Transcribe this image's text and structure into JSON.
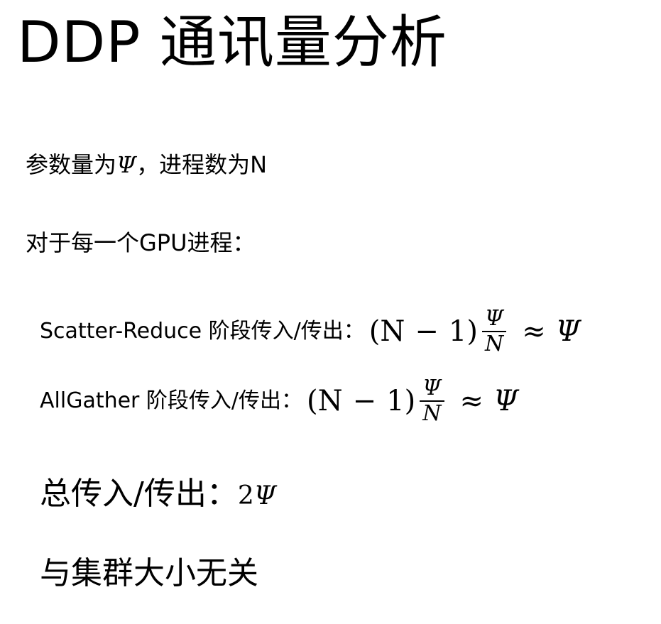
{
  "title": "DDP 通讯量分析",
  "intro": {
    "prefix": "参数量为",
    "var_params": "Ψ",
    "middle": "，进程数为N"
  },
  "per_gpu_label": "对于每一个GPU进程：",
  "scatter_reduce": {
    "label": "Scatter-Reduce 阶段传入/传出：",
    "formula": {
      "lparen": "(N",
      "minus": "−",
      "rparen": "1)",
      "num": "Ψ",
      "den": "N",
      "approx": "≈",
      "result": "Ψ"
    }
  },
  "allgather": {
    "label": "AllGather 阶段传入/传出：",
    "formula": {
      "lparen": "(N",
      "minus": "−",
      "rparen": "1)",
      "num": "Ψ",
      "den": "N",
      "approx": "≈",
      "result": "Ψ"
    }
  },
  "total": {
    "label": "总传入/传出：",
    "value_coef": "2",
    "value_var": "Ψ"
  },
  "conclusion": "与集群大小无关"
}
